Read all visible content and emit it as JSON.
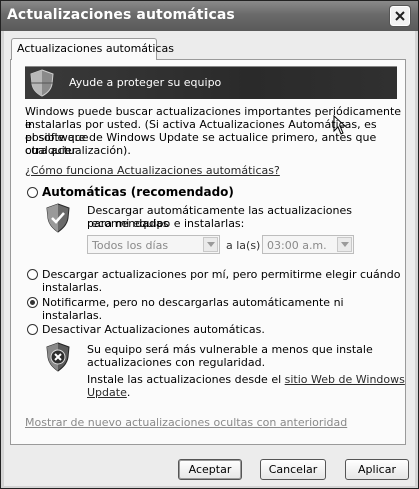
{
  "window": {
    "title": "Actualizaciones automáticas"
  },
  "tab": {
    "label": "Actualizaciones automáticas"
  },
  "banner": {
    "text": "Ayude a proteger su equipo"
  },
  "intro": {
    "line1": "Windows puede buscar actualizaciones importantes periódicamente e",
    "line2": "instalarlas por usted. (Si activa Actualizaciones Automáticas, es posible que",
    "line3": "el software de Windows Update se actualice primero, antes que cualquier",
    "line4": "otra actualización)."
  },
  "how_link": "¿Cómo funciona Actualizaciones automáticas?",
  "options": {
    "automatic": {
      "label": "Automáticas (recomendado)",
      "desc_line1": "Descargar automáticamente las actualizaciones recomendadas",
      "desc_line2": "para mi equipo e instalarlas:",
      "day_value": "Todos los días",
      "at_label": "a la(s)",
      "time_value": "03:00 a.m.",
      "selected": false
    },
    "download": {
      "line1": "Descargar actualizaciones por mí, pero permitirme elegir cuándo",
      "line2": "instalarlas.",
      "selected": false
    },
    "notify": {
      "label": "Notificarme, pero no descargarlas automáticamente ni instalarlas.",
      "selected": true
    },
    "disable": {
      "label": "Desactivar Actualizaciones automáticas.",
      "selected": false,
      "warn_line1": "Su equipo será más vulnerable a menos que instale",
      "warn_line2": "actualizaciones con regularidad.",
      "install_line1_prefix": "Instale las actualizaciones desde el ",
      "install_link_part1": "sitio Web de Windows",
      "install_link_part2": "Update",
      "install_suffix": "."
    }
  },
  "hidden_link": "Mostrar de nuevo actualizaciones ocultas con anterioridad",
  "buttons": {
    "accept": "Aceptar",
    "cancel": "Cancelar",
    "apply": "Aplicar"
  },
  "icons": {
    "banner": "shield-icon",
    "automatic": "shield-check-icon",
    "disable": "shield-x-icon",
    "close": "close-icon",
    "cursor": "mouse-pointer-icon"
  },
  "colors": {
    "titlebar": "#6a6a6a",
    "banner": "#2e2e2e",
    "panel": "#fbfbfb"
  }
}
